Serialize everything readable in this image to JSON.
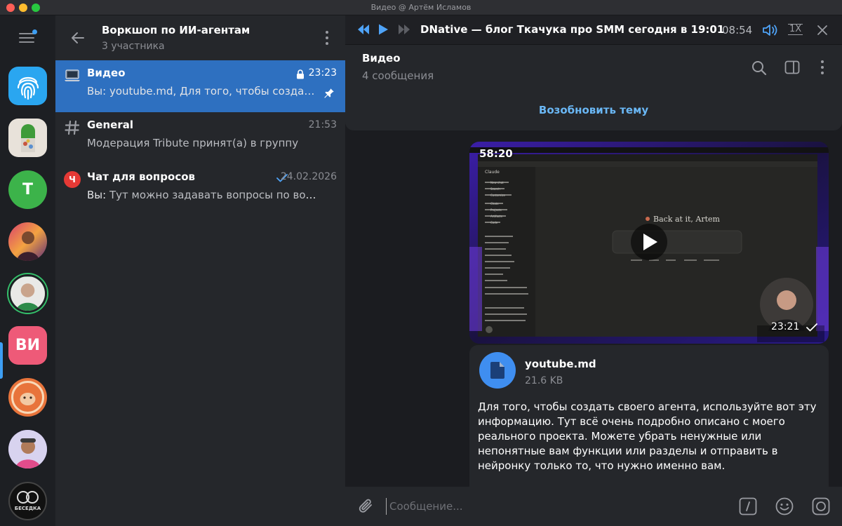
{
  "window": {
    "title": "Видео @ Артём Исламов"
  },
  "rail": {
    "avatars": [
      {
        "name": "fingerprint-folder",
        "letters": ""
      },
      {
        "name": "pill-avatar",
        "letters": ""
      },
      {
        "name": "letter-t-avatar",
        "letters": "T"
      },
      {
        "name": "photo-avatar-1",
        "letters": ""
      },
      {
        "name": "photo-avatar-2",
        "letters": ""
      },
      {
        "name": "group-vi-avatar",
        "letters": "ВИ"
      },
      {
        "name": "photo-avatar-3",
        "letters": ""
      },
      {
        "name": "photo-avatar-4",
        "letters": ""
      },
      {
        "name": "besedka-avatar",
        "letters": "БЕСЕДКА"
      }
    ]
  },
  "list": {
    "title": "Воркшоп по ИИ-агентам",
    "subtitle": "3 участника",
    "items": [
      {
        "name": "Видео",
        "time": "23:23",
        "you": "Вы:",
        "preview": " youtube.md, Для того, чтобы создать своего агента",
        "icon": "laptop-icon",
        "active": true
      },
      {
        "name": "General",
        "time": "21:53",
        "you": "",
        "preview": "Модерация Tribute принят(а) в группу",
        "icon": "hash-icon",
        "active": false
      },
      {
        "name": "Чат для вопросов",
        "time": "24.02.2026",
        "you": "Вы:",
        "preview": " Тут можно задавать вопросы по воркшопу",
        "icon": "question-icon",
        "badge": "Ч",
        "active": false
      }
    ]
  },
  "player": {
    "title": "DNative — блог Ткачука про SMM сегодня в 19:01",
    "time": "08:54",
    "speed": "1X"
  },
  "topic": {
    "title": "Видео",
    "subtitle": "4 сообщения",
    "resume": "Возобновить тему"
  },
  "video": {
    "duration": "58:20",
    "sent_time": "23:21",
    "app_name": "Claude",
    "greeting": "Back at it, Artem",
    "sidebar_items": [
      "New chat",
      "Search",
      "Customize",
      "Chats",
      "Projects",
      "Artifacts",
      "Code"
    ]
  },
  "file": {
    "name": "youtube.md",
    "size": "21.6 KB",
    "text": "Для того, чтобы создать своего агента, используйте вот эту информацию. Тут всё очень подробно описано с моего реального проекта. Можете убрать ненужные или непонятные вам функции или разделы и отправить в нейронку только то, что нужно именно вам."
  },
  "composer": {
    "placeholder": "Сообщение..."
  },
  "colors": {
    "accent": "#3d9ef3",
    "active_row": "#2e70c0",
    "link": "#6ab7f5"
  }
}
